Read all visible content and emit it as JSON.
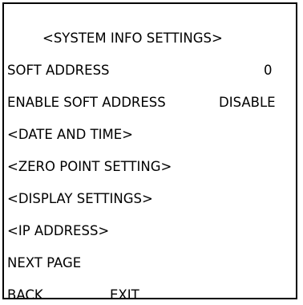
{
  "menu": {
    "title": "<SYSTEM INFO SETTINGS>",
    "items": [
      {
        "label": "SOFT ADDRESS",
        "value": "0"
      },
      {
        "label": "ENABLE SOFT ADDRESS",
        "value": "DISABLE"
      },
      {
        "label": "<DATE AND TIME>"
      },
      {
        "label": "<ZERO POINT SETTING>"
      },
      {
        "label": "<DISPLAY SETTINGS>"
      },
      {
        "label": "<IP ADDRESS>"
      },
      {
        "label": "NEXT PAGE"
      }
    ],
    "back_label": "BACK",
    "exit_label": "EXIT"
  }
}
